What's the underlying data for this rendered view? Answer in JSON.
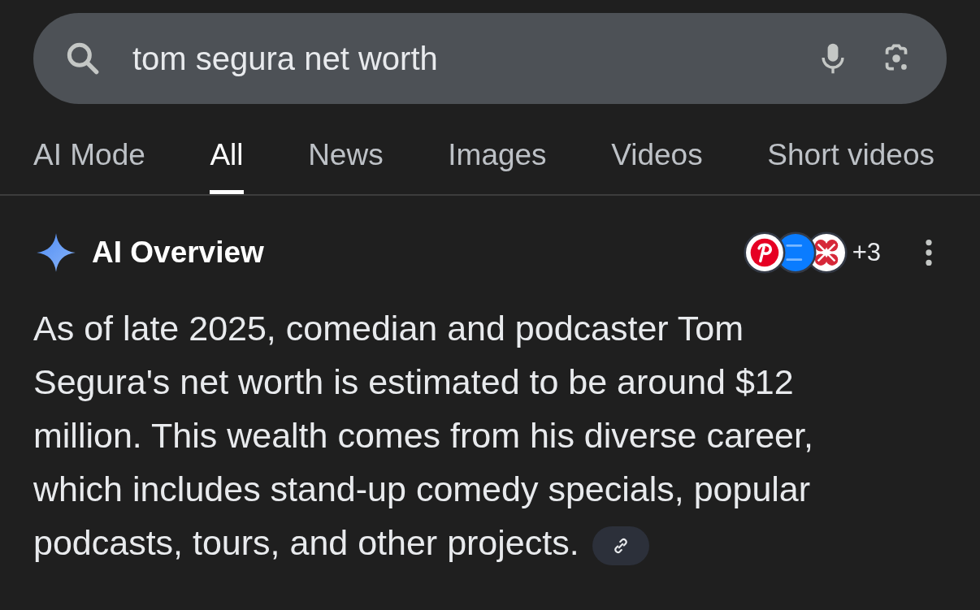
{
  "search": {
    "value": "tom segura net worth"
  },
  "tabs": [
    {
      "label": "AI Mode",
      "selected": false
    },
    {
      "label": "All",
      "selected": true
    },
    {
      "label": "News",
      "selected": false
    },
    {
      "label": "Images",
      "selected": false
    },
    {
      "label": "Videos",
      "selected": false
    },
    {
      "label": "Short videos",
      "selected": false
    }
  ],
  "ai_overview": {
    "title": "AI Overview",
    "sources_more": "+3",
    "text": "As of late 2025, comedian and podcaster Tom Segura's net worth is estimated to be around $12 million. This wealth comes from his diverse career, which includes stand-up comedy specials, popular podcasts, tours, and other projects."
  }
}
